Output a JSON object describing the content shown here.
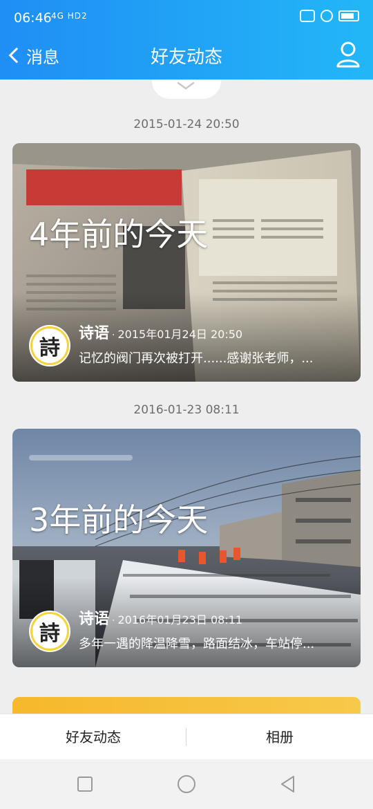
{
  "status_bar": {
    "time": "06:46",
    "network": "4G HD2"
  },
  "header": {
    "back_label": "消息",
    "title": "好友动态"
  },
  "feed": [
    {
      "timestamp": "2015-01-24 20:50",
      "memory_title": "4年前的今天",
      "author": "诗语",
      "post_date": "2015年01月24日 20:50",
      "caption": "记忆的阀门再次被打开......感谢张老师，...",
      "avatar_glyph": "詩"
    },
    {
      "timestamp": "2016-01-23 08:11",
      "memory_title": "3年前的今天",
      "author": "诗语",
      "post_date": "2016年01月23日 08:11",
      "caption": "多年一遇的降温降雪，路面结冰，车站停...",
      "avatar_glyph": "詩"
    }
  ],
  "tabs": [
    {
      "label": "好友动态"
    },
    {
      "label": "相册"
    }
  ],
  "colors": {
    "header_start": "#1f8ef5",
    "header_end": "#23b7f7",
    "avatar_ring": "#f7d23a"
  }
}
